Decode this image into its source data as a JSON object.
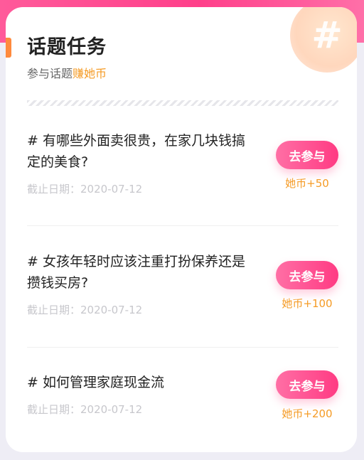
{
  "header": {
    "title": "话题任务",
    "subtitle_prefix": "参与话题",
    "subtitle_highlight": "赚她币",
    "decor_icon": "hash-icon"
  },
  "tasks": [
    {
      "title": "# 有哪些外面卖很贵，在家几块钱搞定的美食?",
      "deadline": "截止日期：2020-07-12",
      "button_label": "去参与",
      "reward": "她币+50"
    },
    {
      "title": "# 女孩年轻时应该注重打扮保养还是攒钱买房?",
      "deadline": "截止日期：2020-07-12",
      "button_label": "去参与",
      "reward": "她币+100"
    },
    {
      "title": "# 如何管理家庭现金流",
      "deadline": "截止日期：2020-07-12",
      "button_label": "去参与",
      "reward": "她币+200"
    }
  ],
  "colors": {
    "accent_orange": "#f59b25",
    "button_pink": "#ff3b83",
    "top_band_pink": "#ff4f92"
  }
}
